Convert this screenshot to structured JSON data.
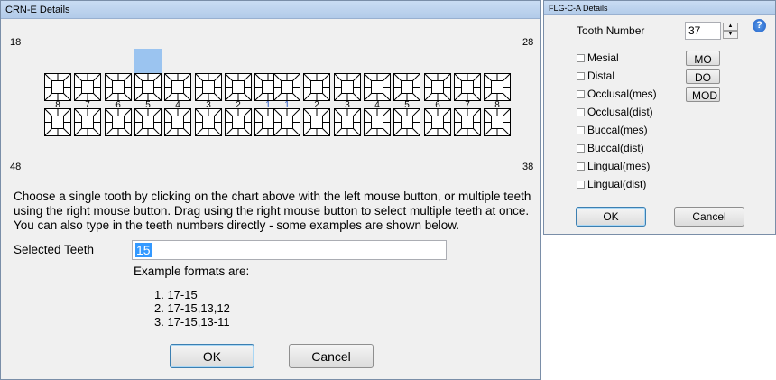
{
  "crn": {
    "title": "CRN-E Details",
    "corner_top_left": "18",
    "corner_top_right": "28",
    "corner_bottom_left": "48",
    "corner_bottom_right": "38",
    "upper_right_quadrant": [
      "8",
      "7",
      "6",
      "5",
      "4",
      "3",
      "2",
      "1"
    ],
    "upper_left_quadrant": [
      "1",
      "2",
      "3",
      "4",
      "5",
      "6",
      "7",
      "8"
    ],
    "selected_tooth": "5",
    "instructions_line1": "Choose a single tooth by clicking on the chart above with the left mouse button, or multiple teeth",
    "instructions_line2": "using the right mouse button. Drag using the right mouse button to select multiple teeth at once.",
    "instructions_line3": "You can also type in the teeth numbers directly - some examples are shown below.",
    "selected_label": "Selected Teeth",
    "selected_value": "15",
    "examples_title": "Example formats are:",
    "examples": [
      "1. 17-15",
      "2. 17-15,13,12",
      "3. 17-15,13-11"
    ],
    "ok_label": "OK",
    "cancel_label": "Cancel"
  },
  "flg": {
    "title": "FLG-C-A Details",
    "tooth_number_label": "Tooth Number",
    "tooth_number_value": "37",
    "surfaces": [
      {
        "label": "Mesial",
        "button": "MO"
      },
      {
        "label": "Distal",
        "button": "DO"
      },
      {
        "label": "Occlusal(mes)",
        "button": "MOD"
      },
      {
        "label": "Occlusal(dist)",
        "button": ""
      },
      {
        "label": "Buccal(mes)",
        "button": ""
      },
      {
        "label": "Buccal(dist)",
        "button": ""
      },
      {
        "label": "Lingual(mes)",
        "button": ""
      },
      {
        "label": "Lingual(dist)",
        "button": ""
      }
    ],
    "ok_label": "OK",
    "cancel_label": "Cancel",
    "help_glyph": "?"
  },
  "colors": {
    "selection": "#3399ff",
    "tooth_highlight": "#8cbcf0",
    "title_bar": "#b9d1ea"
  }
}
